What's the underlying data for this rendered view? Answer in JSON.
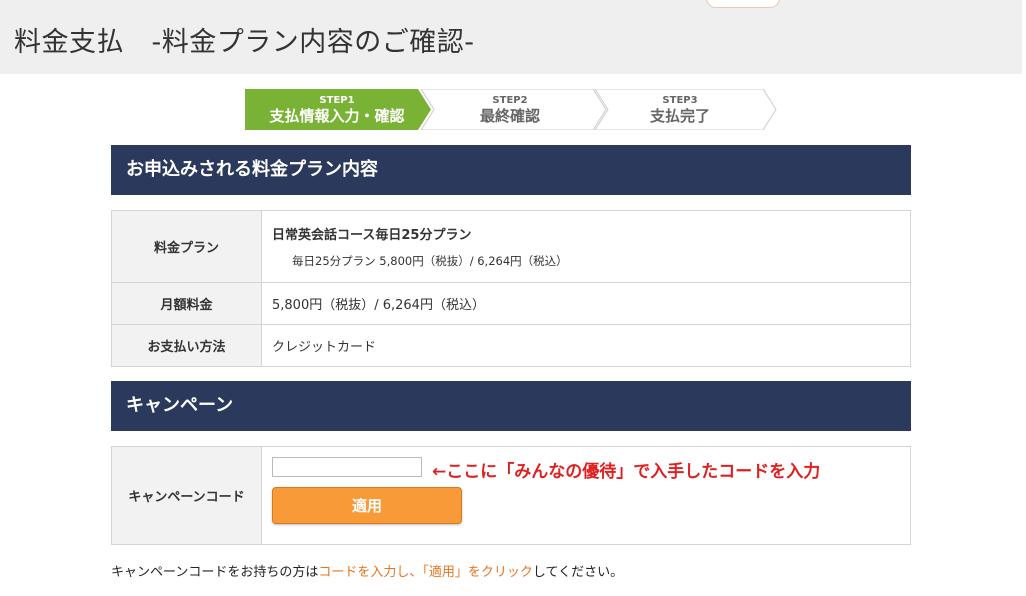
{
  "page": {
    "title": "料金支払　-料金プラン内容のご確認-"
  },
  "steps": [
    {
      "num": "STEP1",
      "label": "支払情報入力・確認"
    },
    {
      "num": "STEP2",
      "label": "最終確認"
    },
    {
      "num": "STEP3",
      "label": "支払完了"
    }
  ],
  "plan_section": {
    "heading": "お申込みされる料金プラン内容",
    "rows": {
      "plan_label": "料金プラン",
      "plan_name": "日常英会話コース毎日25分プラン",
      "plan_detail": "毎日25分プラン 5,800円（税抜）/ 6,264円（税込）",
      "fee_label": "月額料金",
      "fee_value": "5,800円（税抜）/ 6,264円（税込）",
      "method_label": "お支払い方法",
      "method_value": "クレジットカード"
    }
  },
  "campaign_section": {
    "heading": "キャンペーン",
    "code_label": "キャンペーンコード",
    "code_value": "",
    "annotation": "←ここに「みんなの優待」で入手したコードを入力",
    "apply_label": "適用"
  },
  "footer": {
    "part1": "キャンペーンコードをお持ちの方は",
    "part2": "コードを入力し、「適用」をクリック",
    "part3": "してください。"
  },
  "colors": {
    "header_bg": "#efefef",
    "step_active": "#7ab236",
    "section_bar": "#2b3a5c",
    "button": "#f89a38",
    "annotation": "#e02020",
    "highlight": "#e9731e"
  }
}
